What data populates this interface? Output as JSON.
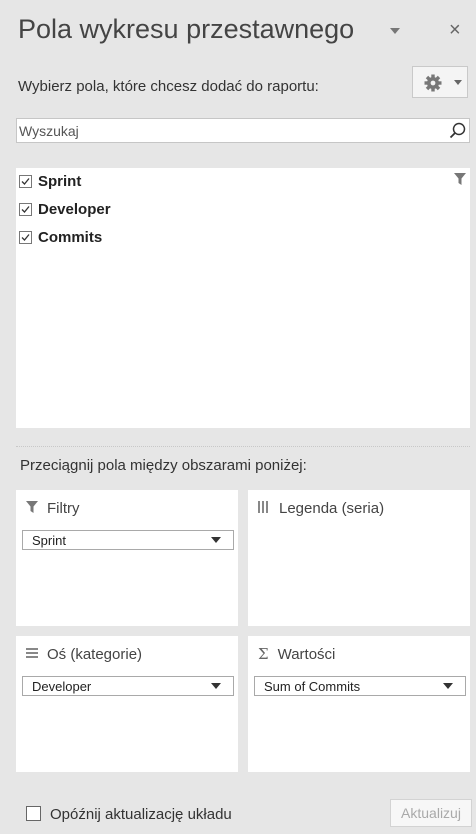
{
  "pane": {
    "title": "Pola wykresu przestawnego",
    "close_glyph": "×",
    "subtitle": "Wybierz pola, które chcesz dodać do raportu:"
  },
  "search": {
    "placeholder": "Wyszukaj"
  },
  "fields": [
    {
      "label": "Sprint",
      "checked": true
    },
    {
      "label": "Developer",
      "checked": true
    },
    {
      "label": "Commits",
      "checked": true
    }
  ],
  "areas": {
    "instruction": "Przeciągnij pola między obszarami poniżej:",
    "filters": {
      "title": "Filtry",
      "items": [
        "Sprint"
      ]
    },
    "legend": {
      "title": "Legenda (seria)",
      "items": []
    },
    "axis": {
      "title": "Oś (kategorie)",
      "items": [
        "Developer"
      ]
    },
    "values": {
      "title": "Wartości",
      "items": [
        "Sum of Commits"
      ]
    }
  },
  "footer": {
    "defer_label": "Opóźnij aktualizację układu",
    "update_label": "Aktualizuj"
  },
  "icons": {
    "settings": "gear-icon",
    "search": "search-icon",
    "filter": "filter-icon",
    "legend": "columns-icon",
    "axis": "rows-icon",
    "values": "sigma-icon"
  }
}
